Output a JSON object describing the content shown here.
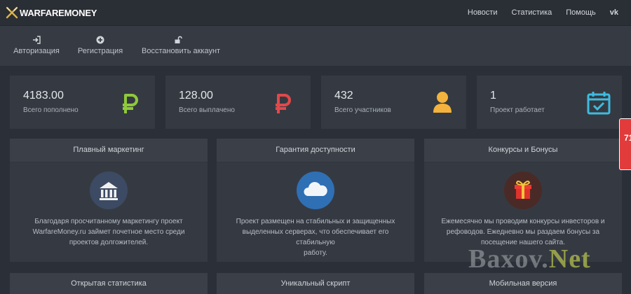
{
  "header": {
    "logo_text": "WARFAREMONEY",
    "nav": [
      "Новости",
      "Статистика",
      "Помощь"
    ],
    "vk_label": "vk"
  },
  "subnav": {
    "items": [
      {
        "label": "Авторизация",
        "icon": "sign-in-icon"
      },
      {
        "label": "Регистрация",
        "icon": "plus-circle-icon"
      },
      {
        "label": "Восстановить аккаунт",
        "icon": "unlock-icon"
      }
    ]
  },
  "stats": [
    {
      "value": "4183.00",
      "label": "Всего пополнено",
      "icon": "ruble-icon",
      "color": "#8fc93a"
    },
    {
      "value": "128.00",
      "label": "Всего выплачено",
      "icon": "ruble-icon",
      "color": "#e2484a"
    },
    {
      "value": "432",
      "label": "Всего участников",
      "icon": "user-icon",
      "color": "#f3b33d"
    },
    {
      "value": "1",
      "label": "Проект работает",
      "icon": "calendar-check-icon",
      "color": "#3fbbe0"
    }
  ],
  "features": [
    {
      "title": "Плавный маркетинг",
      "icon": "bank-icon",
      "circle_color": "#3c4a63",
      "lines": [
        "Благодаря просчитанному маркетингу проект",
        "WarfareMoney.ru займет почетное место среди",
        "проектов долгожителей."
      ]
    },
    {
      "title": "Гарантия доступности",
      "icon": "cloud-icon",
      "circle_color": "#2f6fb4",
      "lines": [
        "Проект размещен на стабильных и защищенных",
        "выделенных серверах, что обеспечивает его стабильную",
        "работу."
      ]
    },
    {
      "title": "Конкурсы и Бонусы",
      "icon": "gift-icon",
      "circle_color": "#4a2a26",
      "lines": [
        "Ежемесячно мы проводим конкурсы инвесторов и",
        "рефоводов. Ежедневно мы раздаем бонусы за",
        "посещение нашего сайта."
      ]
    }
  ],
  "features_row2": [
    "Открытая статистика",
    "Уникальный скрипт",
    "Мобильная версия"
  ],
  "side_tab": {
    "text": "71"
  },
  "watermark": {
    "part1": "Baxov.",
    "part2": "Net"
  }
}
